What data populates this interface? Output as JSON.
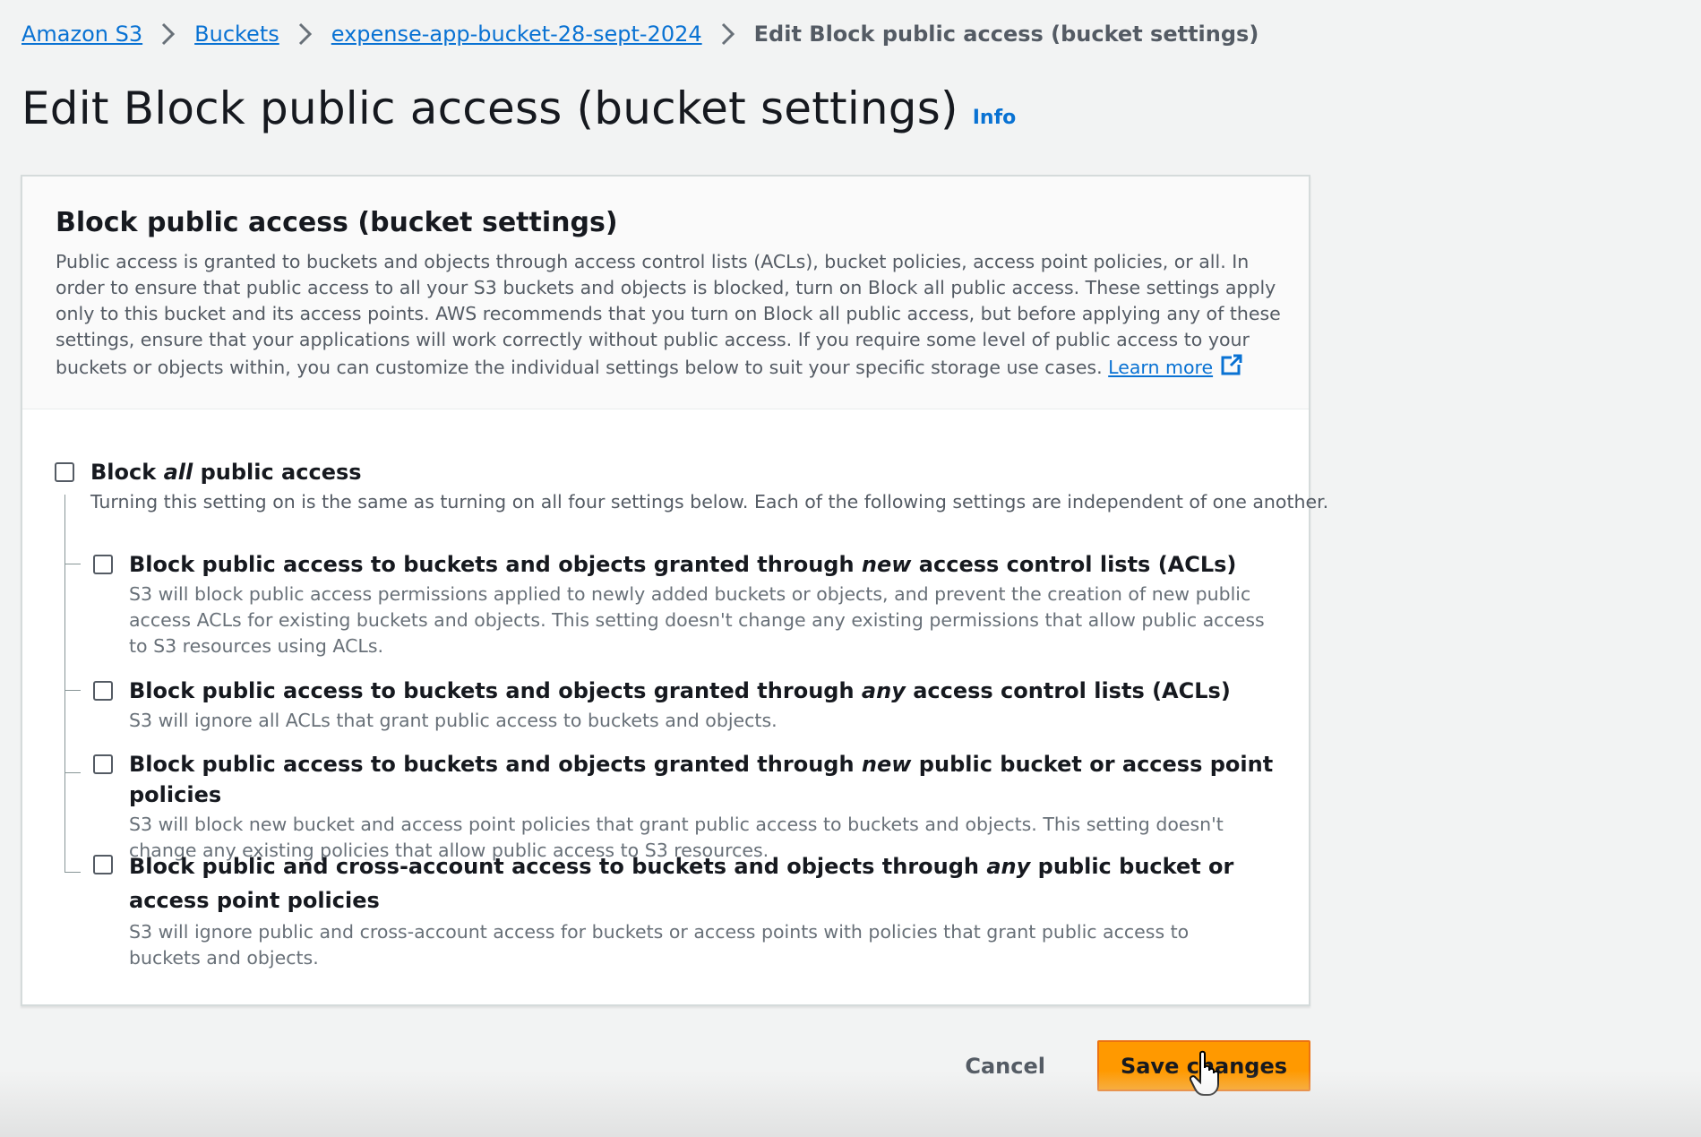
{
  "breadcrumbs": {
    "items": [
      {
        "label": "Amazon S3"
      },
      {
        "label": "Buckets"
      },
      {
        "label": "expense-app-bucket-28-sept-2024"
      },
      {
        "label": "Edit Block public access (bucket settings)"
      }
    ]
  },
  "page": {
    "title": "Edit Block public access (bucket settings)",
    "info_label": "Info"
  },
  "section": {
    "title": "Block public access (bucket settings)",
    "description": "Public access is granted to buckets and objects through access control lists (ACLs), bucket policies, access point policies, or all. In order to ensure that public access to all your S3 buckets and objects is blocked, turn on Block all public access. These settings apply only to this bucket and its access points. AWS recommends that you turn on Block all public access, but before applying any of these settings, ensure that your applications will work correctly without public access. If you require some level of public access to your buckets or objects within, you can customize the individual settings below to suit your specific storage use cases.",
    "learn_more": "Learn more"
  },
  "options": {
    "block_all": {
      "title_pre": "Block ",
      "title_em": "all",
      "title_post": " public access",
      "description": "Turning this setting on is the same as turning on all four settings below. Each of the following settings are independent of one another.",
      "checked": false
    },
    "items": [
      {
        "title_pre": "Block public access to buckets and objects granted through ",
        "title_em": "new",
        "title_post": " access control lists (ACLs)",
        "description": "S3 will block public access permissions applied to newly added buckets or objects, and prevent the creation of new public access ACLs for existing buckets and objects. This setting doesn't change any existing permissions that allow public access to S3 resources using ACLs.",
        "checked": false
      },
      {
        "title_pre": "Block public access to buckets and objects granted through ",
        "title_em": "any",
        "title_post": " access control lists (ACLs)",
        "description": "S3 will ignore all ACLs that grant public access to buckets and objects.",
        "checked": false
      },
      {
        "title_pre": "Block public access to buckets and objects granted through ",
        "title_em": "new",
        "title_post": " public bucket or access point policies",
        "description": "S3 will block new bucket and access point policies that grant public access to buckets and objects. This setting doesn't change any existing policies that allow public access to S3 resources.",
        "checked": false
      },
      {
        "title_pre": "Block public and cross-account access to buckets and objects through ",
        "title_em": "any",
        "title_post": " public bucket or access point policies",
        "description": "S3 will ignore public and cross-account access for buckets or access points with policies that grant public access to buckets and objects.",
        "checked": false
      }
    ]
  },
  "actions": {
    "cancel_label": "Cancel",
    "save_label": "Save changes"
  },
  "colors": {
    "link": "#0972d3",
    "primary_button": "#ff9900",
    "background": "#f2f3f3"
  },
  "icons": {
    "breadcrumb_separator": "chevron-right-icon",
    "external_link": "external-link-icon",
    "cursor": "hand-pointer-cursor-icon"
  }
}
